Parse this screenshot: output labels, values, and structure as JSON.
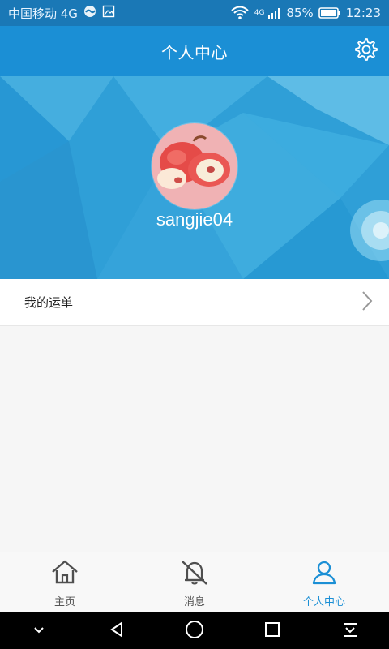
{
  "status_bar": {
    "carrier": "中国移动 4G",
    "battery": "85%",
    "time": "12:23",
    "network_label": "4G",
    "icons": [
      "weather-icon",
      "gallery-icon",
      "wifi-icon",
      "signal-icon",
      "battery-icon"
    ]
  },
  "header": {
    "title": "个人中心",
    "settings_icon": "gear-icon"
  },
  "profile": {
    "username": "sangjie04"
  },
  "menu": {
    "items": [
      {
        "label": "我的运单",
        "icon": "chevron-right-icon"
      }
    ]
  },
  "bottom_nav": {
    "items": [
      {
        "label": "主页",
        "icon": "home-icon",
        "active": false
      },
      {
        "label": "消息",
        "icon": "bell-muted-icon",
        "active": false
      },
      {
        "label": "个人中心",
        "icon": "user-icon",
        "active": true
      }
    ]
  },
  "android_nav": {
    "buttons": [
      "chevron-down-icon",
      "back-icon",
      "home-circle-icon",
      "recent-apps-icon",
      "notification-pull-icon"
    ]
  },
  "colors": {
    "primary": "#1b8fd5",
    "status_bar": "#1a78b6",
    "active": "#1b8fd5",
    "background": "#f6f6f6"
  }
}
